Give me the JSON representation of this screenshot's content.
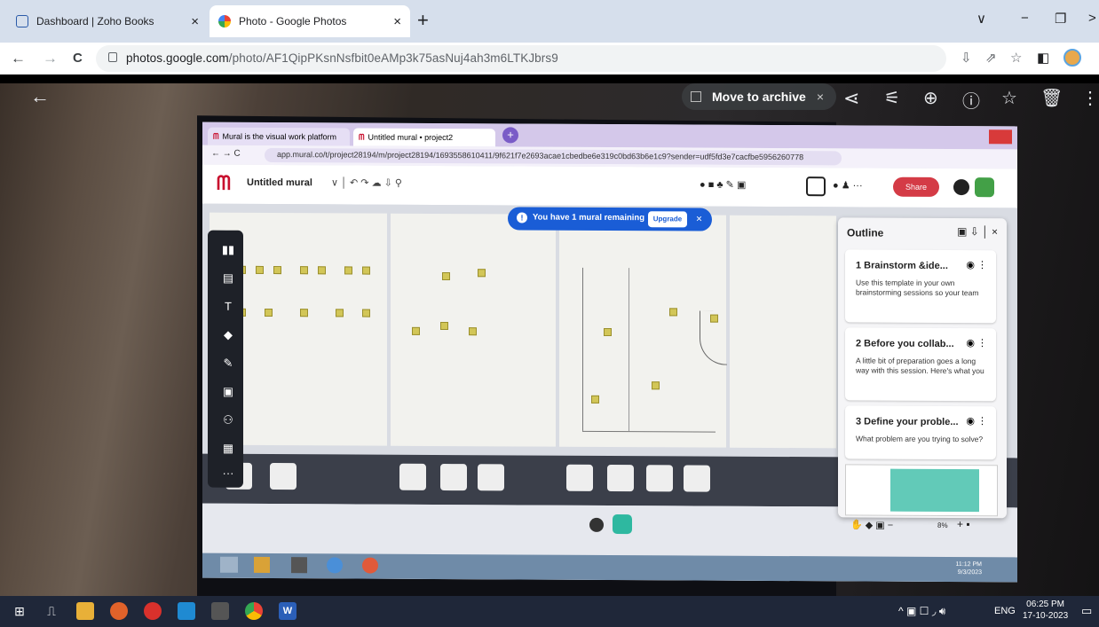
{
  "tabs": [
    {
      "title": "Dashboard | Zoho Books",
      "close": "×"
    },
    {
      "title": "Photo - Google Photos",
      "close": "×"
    }
  ],
  "new_tab": "+",
  "window_controls": {
    "dropdown": "∨",
    "minimize": "−",
    "restore": "❐",
    "more": ">"
  },
  "address_bar": {
    "url_host": "photos.google.com",
    "url_path": "/photo/AF1QipPKsnNsfbit0eAMp3k75asNuj4ah3m6LTKJbrs9"
  },
  "viewer": {
    "archive_label": "Move to archive",
    "archive_close": "×",
    "back": "←"
  },
  "photo": {
    "inner_tabs": [
      {
        "title": "Mural is the visual work platform"
      },
      {
        "title": "Untitled mural • project2"
      }
    ],
    "inner_url": "app.mural.co/t/project28194/m/project28194/1693558610411/9f621f7e2693acae1cbedbe6e319c0bd63b6e1c9?sender=udf5fd3e7cacfbe5956260778",
    "mural_title": "Untitled mural",
    "banner_text": "You have 1 mural remaining",
    "banner_button": "Upgrade",
    "share_label": "Share",
    "outline": {
      "title": "Outline",
      "items": [
        {
          "title": "1  Brainstorm &ide...",
          "desc": "Use this template in your own brainstorming sessions so your team"
        },
        {
          "title": "2  Before you collab...",
          "desc": "A little bit of preparation goes a long way with this session. Here's what you"
        },
        {
          "title": "3  Define your proble...",
          "desc": "What problem are you trying to solve?"
        }
      ]
    },
    "zoom_level": "8%",
    "inner_clock": {
      "time": "11:12 PM",
      "date": "9/3/2023"
    }
  },
  "taskbar": {
    "lang": "ENG",
    "time": "06:25 PM",
    "date": "17-10-2023"
  },
  "colors": {
    "tabstrip": "#d6dfec",
    "taskbar": "#1f2739",
    "mural_red": "#c8102e",
    "banner_blue": "#1a5dd6",
    "outline_teal": "#2eb8a0"
  }
}
